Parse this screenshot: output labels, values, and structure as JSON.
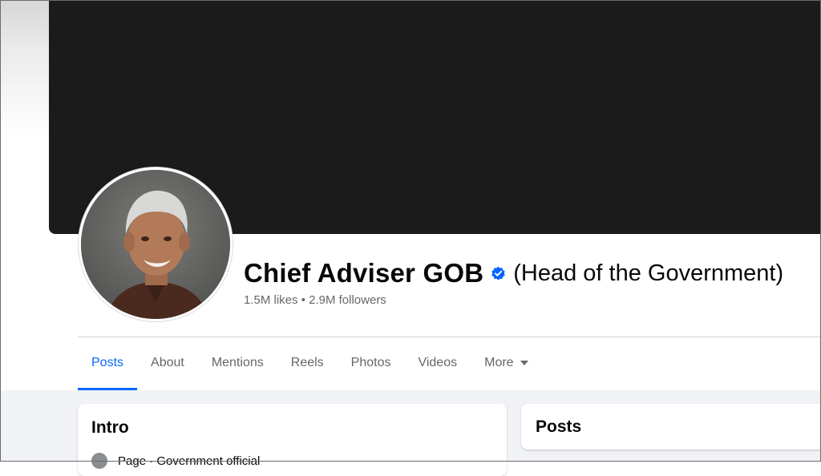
{
  "profile": {
    "name": "Chief Adviser GOB",
    "name_suffix": "(Head of the Government)",
    "stats": "1.5M likes • 2.9M followers",
    "verified_icon": "verified-badge-icon",
    "avatar": "profile-photo"
  },
  "tabs": [
    {
      "label": "Posts",
      "active": true
    },
    {
      "label": "About"
    },
    {
      "label": "Mentions"
    },
    {
      "label": "Reels"
    },
    {
      "label": "Photos"
    },
    {
      "label": "Videos"
    },
    {
      "label": "More",
      "icon": "caret-down-icon"
    }
  ],
  "intro": {
    "title": "Intro",
    "category": "Page · Government official"
  },
  "posts": {
    "title": "Posts"
  },
  "colors": {
    "accent": "#0866ff",
    "cover": "#1c1b1c",
    "feed_background": "#f0f2f5",
    "muted_text": "#65676b"
  }
}
